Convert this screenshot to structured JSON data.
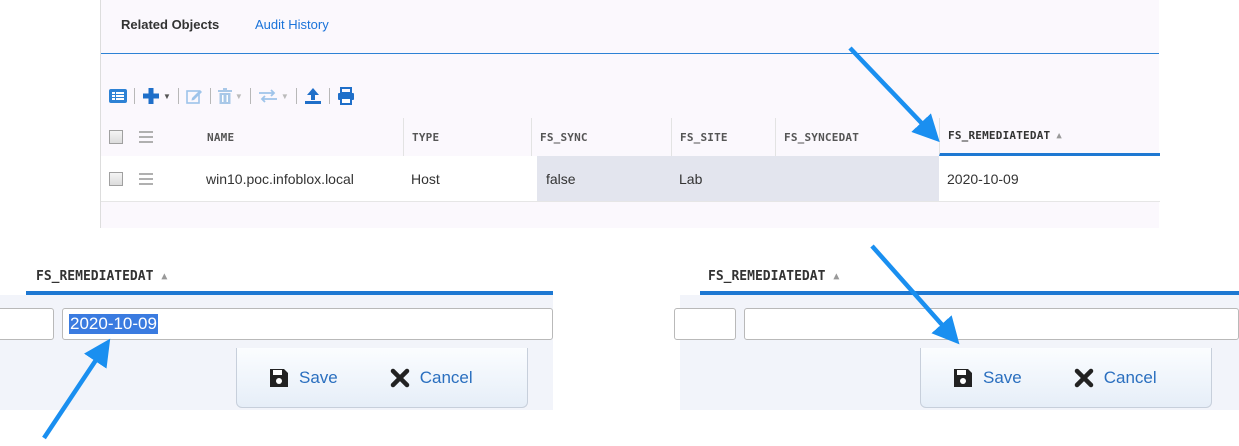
{
  "tabs": {
    "related": "Related Objects",
    "audit": "Audit History"
  },
  "toolbar": {
    "icons": [
      "list-view-icon",
      "add-icon",
      "edit-icon",
      "delete-icon",
      "move-icon",
      "export-icon",
      "print-icon"
    ]
  },
  "grid": {
    "columns": [
      "NAME",
      "TYPE",
      "FS_SYNC",
      "FS_SITE",
      "FS_SYNCEDAT",
      "FS_REMEDIATEDAT"
    ],
    "sorted_column": "FS_REMEDIATEDAT",
    "rows": [
      {
        "name": "win10.poc.infoblox.local",
        "type": "Host",
        "fs_sync": "false",
        "fs_site": "Lab",
        "fs_syncedat": "",
        "fs_remediatedat": "2020-10-09"
      }
    ]
  },
  "inset_left": {
    "column_header": "FS_REMEDIATEDAT",
    "field_value": "2020-10-09",
    "save_label": "Save",
    "cancel_label": "Cancel"
  },
  "inset_right": {
    "column_header": "FS_REMEDIATEDAT",
    "field_value": "",
    "save_label": "Save",
    "cancel_label": "Cancel"
  },
  "colors": {
    "accent": "#1e78d2",
    "link": "#1a73d9",
    "arrow": "#1a8ff0",
    "highlight": "#e3e5ee"
  }
}
